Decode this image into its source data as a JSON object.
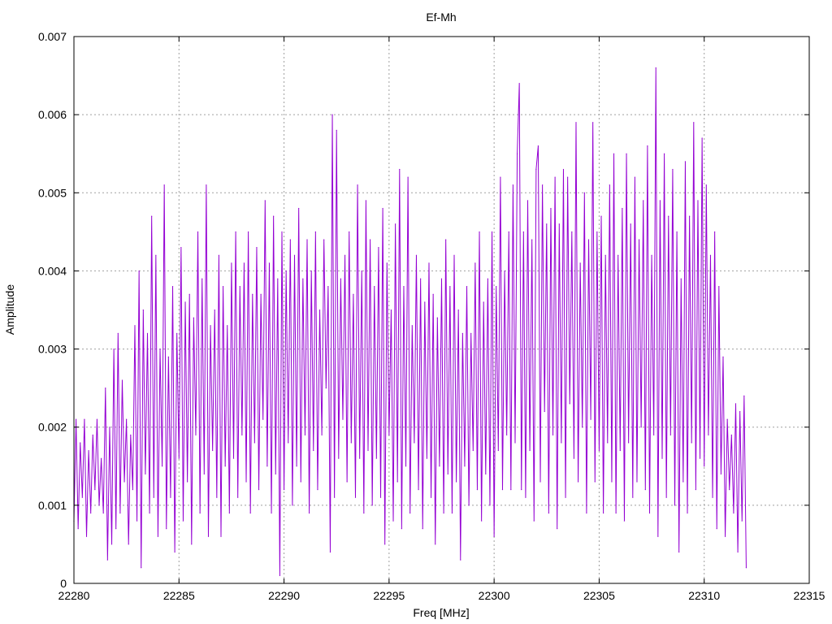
{
  "chart_data": {
    "type": "line",
    "title": "Ef-Mh",
    "xlabel": "Freq [MHz]",
    "ylabel": "Amplitude",
    "xlim": [
      22280,
      22315
    ],
    "ylim": [
      0,
      0.007
    ],
    "x_ticks": [
      "22280",
      "22285",
      "22290",
      "22295",
      "22300",
      "22305",
      "22310",
      "22315"
    ],
    "y_ticks": [
      "0",
      "0.001",
      "0.002",
      "0.003",
      "0.004",
      "0.005",
      "0.006",
      "0.007"
    ],
    "x_tick_values": [
      22280,
      22285,
      22290,
      22295,
      22300,
      22305,
      22310,
      22315
    ],
    "y_tick_values": [
      0,
      0.001,
      0.002,
      0.003,
      0.004,
      0.005,
      0.006,
      0.007
    ],
    "grid": true,
    "series": [
      {
        "color": "#9400d3",
        "x_start": 22280,
        "x_step": 0.1,
        "values": [
          0.0008,
          0.0021,
          0.0007,
          0.0018,
          0.0011,
          0.0021,
          0.0006,
          0.0017,
          0.0009,
          0.0019,
          0.0012,
          0.0021,
          0.001,
          0.0016,
          0.0009,
          0.0025,
          0.0003,
          0.002,
          0.0005,
          0.003,
          0.0007,
          0.0032,
          0.0009,
          0.0026,
          0.0013,
          0.0021,
          0.0005,
          0.0019,
          0.0012,
          0.0033,
          0.0008,
          0.004,
          0.0002,
          0.0035,
          0.0014,
          0.0032,
          0.0009,
          0.0047,
          0.0011,
          0.0042,
          0.0006,
          0.003,
          0.0015,
          0.0051,
          0.0007,
          0.0029,
          0.0011,
          0.0038,
          0.0004,
          0.0032,
          0.0016,
          0.0043,
          0.0008,
          0.0036,
          0.0013,
          0.0037,
          0.0005,
          0.0034,
          0.0019,
          0.0045,
          0.0009,
          0.0039,
          0.0014,
          0.0051,
          0.0006,
          0.0033,
          0.0017,
          0.0035,
          0.0011,
          0.0042,
          0.0006,
          0.0038,
          0.0015,
          0.0033,
          0.0009,
          0.0041,
          0.0016,
          0.0045,
          0.0011,
          0.0038,
          0.0019,
          0.0041,
          0.0013,
          0.0045,
          0.0009,
          0.0037,
          0.0018,
          0.0043,
          0.0012,
          0.0037,
          0.0021,
          0.0049,
          0.0015,
          0.0041,
          0.0009,
          0.0047,
          0.0014,
          0.0039,
          0.0001,
          0.0045,
          0.0012,
          0.004,
          0.0018,
          0.0044,
          0.001,
          0.0042,
          0.0015,
          0.0048,
          0.0013,
          0.0039,
          0.0019,
          0.0044,
          0.0009,
          0.004,
          0.0017,
          0.0045,
          0.0012,
          0.0035,
          0.0019,
          0.0044,
          0.0025,
          0.0038,
          0.0004,
          0.006,
          0.0011,
          0.0058,
          0.0016,
          0.0039,
          0.0021,
          0.0042,
          0.0013,
          0.0045,
          0.0018,
          0.0037,
          0.0011,
          0.0051,
          0.0016,
          0.004,
          0.0009,
          0.0049,
          0.0017,
          0.0044,
          0.001,
          0.0038,
          0.0016,
          0.0043,
          0.0011,
          0.0048,
          0.0005,
          0.0041,
          0.0019,
          0.0035,
          0.0008,
          0.0046,
          0.0013,
          0.0053,
          0.0007,
          0.0038,
          0.0015,
          0.0052,
          0.0009,
          0.0033,
          0.0018,
          0.0042,
          0.0012,
          0.0039,
          0.0007,
          0.0036,
          0.0016,
          0.0041,
          0.0011,
          0.0037,
          0.0005,
          0.0034,
          0.0015,
          0.0039,
          0.0009,
          0.0044,
          0.0014,
          0.0038,
          0.0009,
          0.0042,
          0.0013,
          0.0035,
          0.0003,
          0.0032,
          0.0015,
          0.0038,
          0.001,
          0.0032,
          0.0017,
          0.0041,
          0.0012,
          0.0045,
          0.0008,
          0.0036,
          0.0014,
          0.0039,
          0.001,
          0.0045,
          0.0006,
          0.0038,
          0.0017,
          0.0052,
          0.0012,
          0.004,
          0.0019,
          0.0045,
          0.0012,
          0.0051,
          0.0018,
          0.0055,
          0.0064,
          0.0012,
          0.0045,
          0.0011,
          0.0049,
          0.0017,
          0.0044,
          0.0008,
          0.0053,
          0.0056,
          0.0013,
          0.0051,
          0.0022,
          0.0046,
          0.0009,
          0.0048,
          0.0019,
          0.0052,
          0.0007,
          0.0046,
          0.0018,
          0.0053,
          0.0011,
          0.0052,
          0.0023,
          0.0045,
          0.0016,
          0.0059,
          0.0013,
          0.0041,
          0.002,
          0.005,
          0.0009,
          0.0044,
          0.0021,
          0.0059,
          0.0013,
          0.0045,
          0.0017,
          0.0047,
          0.0009,
          0.0042,
          0.0018,
          0.0051,
          0.0013,
          0.0055,
          0.0009,
          0.0042,
          0.0017,
          0.0048,
          0.0008,
          0.0055,
          0.0018,
          0.0046,
          0.0011,
          0.0052,
          0.0013,
          0.0044,
          0.002,
          0.0049,
          0.0012,
          0.0056,
          0.0009,
          0.0042,
          0.0019,
          0.0066,
          0.0006,
          0.0049,
          0.0016,
          0.0055,
          0.0011,
          0.0047,
          0.0019,
          0.0053,
          0.001,
          0.0045,
          0.0004,
          0.0039,
          0.0013,
          0.0054,
          0.0009,
          0.0047,
          0.0018,
          0.0059,
          0.0012,
          0.0049,
          0.0016,
          0.0057,
          0.0015,
          0.0051,
          0.0019,
          0.0042,
          0.0011,
          0.0045,
          0.0007,
          0.0038,
          0.0014,
          0.0029,
          0.0006,
          0.0021,
          0.0012,
          0.0019,
          0.0009,
          0.0023,
          0.0004,
          0.0022,
          0.0008,
          0.0024,
          0.0002
        ]
      }
    ]
  }
}
